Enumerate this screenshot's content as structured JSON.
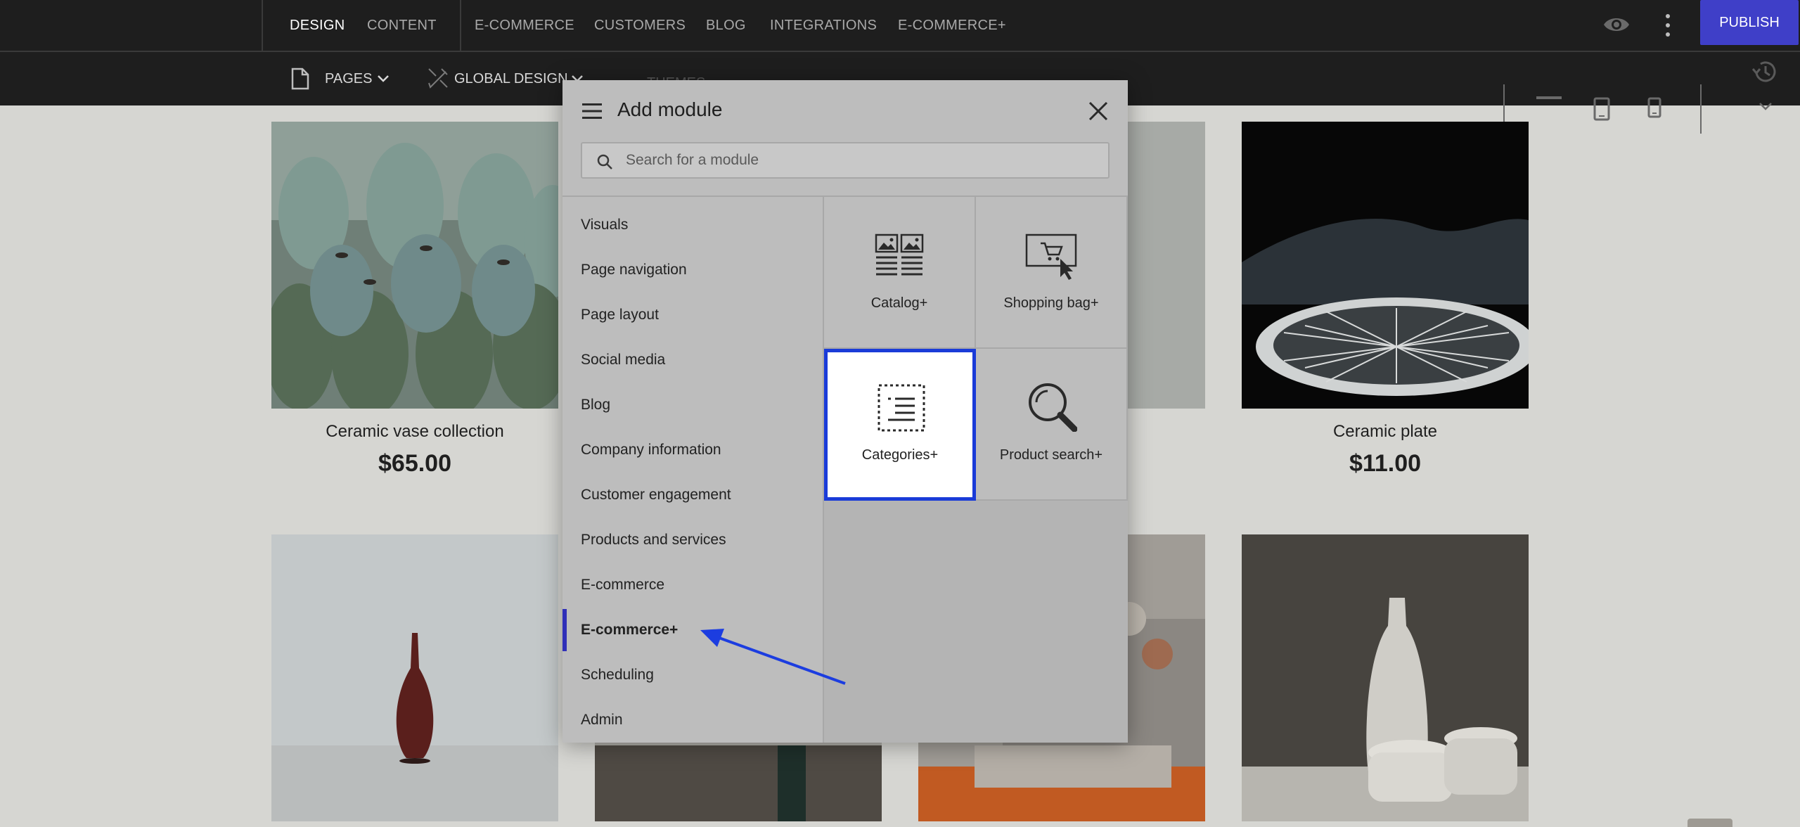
{
  "topbar": {
    "tabs": [
      "DESIGN",
      "CONTENT",
      "E-COMMERCE",
      "CUSTOMERS",
      "BLOG",
      "INTEGRATIONS",
      "E-COMMERCE+"
    ],
    "active_tab": "DESIGN",
    "publish_label": "PUBLISH"
  },
  "subbar": {
    "pages_label": "PAGES",
    "global_design_label": "GLOBAL DESIGN",
    "themes_label": "THEMES"
  },
  "products": [
    {
      "title": "Ceramic vase collection",
      "price": "$65.00"
    },
    {
      "title": "Ceramic plate",
      "price": "$11.00"
    }
  ],
  "modal": {
    "title": "Add module",
    "search_placeholder": "Search for a module",
    "categories": [
      "Visuals",
      "Page navigation",
      "Page layout",
      "Social media",
      "Blog",
      "Company information",
      "Customer engagement",
      "Products and services",
      "E-commerce",
      "E-commerce+",
      "Scheduling",
      "Admin"
    ],
    "active_category": "E-commerce+",
    "modules": [
      {
        "label": "Catalog+",
        "icon": "catalog-icon"
      },
      {
        "label": "Shopping bag+",
        "icon": "shopping-bag-icon"
      },
      {
        "label": "Categories+",
        "icon": "categories-icon"
      },
      {
        "label": "Product search+",
        "icon": "search-icon"
      }
    ],
    "selected_module": "Categories+"
  },
  "colors": {
    "accent": "#1a3bd8",
    "publish": "#3f3fc8",
    "topbar": "#1e1e1e"
  }
}
